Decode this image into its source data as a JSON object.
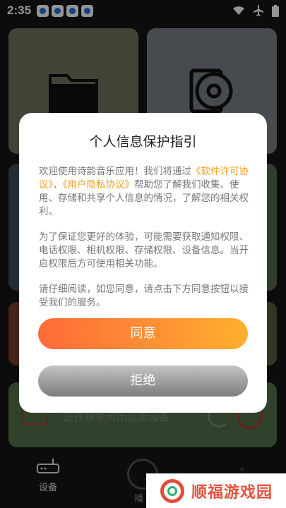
{
  "status": {
    "time": "2:35"
  },
  "bg": {
    "bottom_card_text": "正在搜索可用连接设备",
    "tabs": {
      "device_label": "设备",
      "play_label": "播"
    }
  },
  "dialog": {
    "title": "个人信息保护指引",
    "p1_prefix": "欢迎使用诗韵音乐应用！我们将通过",
    "link_software": "《软件许可协议》",
    "link_sep": "、",
    "link_privacy": "《用户隐私协议》",
    "p1_suffix": "帮助您了解我们收集、使用、存储和共享个人信息的情况，了解您的相关权利。",
    "p2": "为了保证您更好的体验，可能需要获取通知权限、电话权限、相机权限、存储权限、设备信息。当开启权限后方可使用相关功能。",
    "p3": "请仔细阅读，如您同意，请点击下方同意按钮以接受我们的服务。",
    "agree_label": "同意",
    "refuse_label": "拒绝"
  },
  "watermark": {
    "text": "顺福游戏园"
  }
}
